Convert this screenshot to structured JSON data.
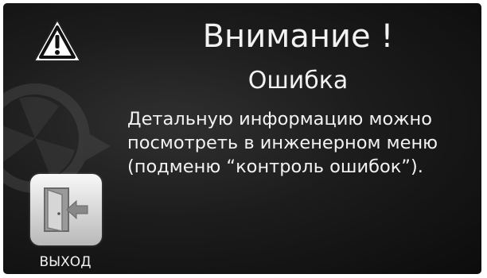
{
  "dialog": {
    "title": "Внимание !",
    "subtitle": "Ошибка",
    "message_lines": [
      "Детальную информацию можно",
      "посмотреть в инженерном меню",
      "(подменю “контроль ошибок”)."
    ]
  },
  "icons": {
    "warning": "warning-triangle-icon",
    "watermark": "fan-refresh-icon",
    "exit": "exit-door-icon"
  },
  "exit_button": {
    "label": "ВЫХОД"
  },
  "colors": {
    "background": "#111111",
    "text": "#f2f2f2",
    "button": "#c8c8c8"
  }
}
